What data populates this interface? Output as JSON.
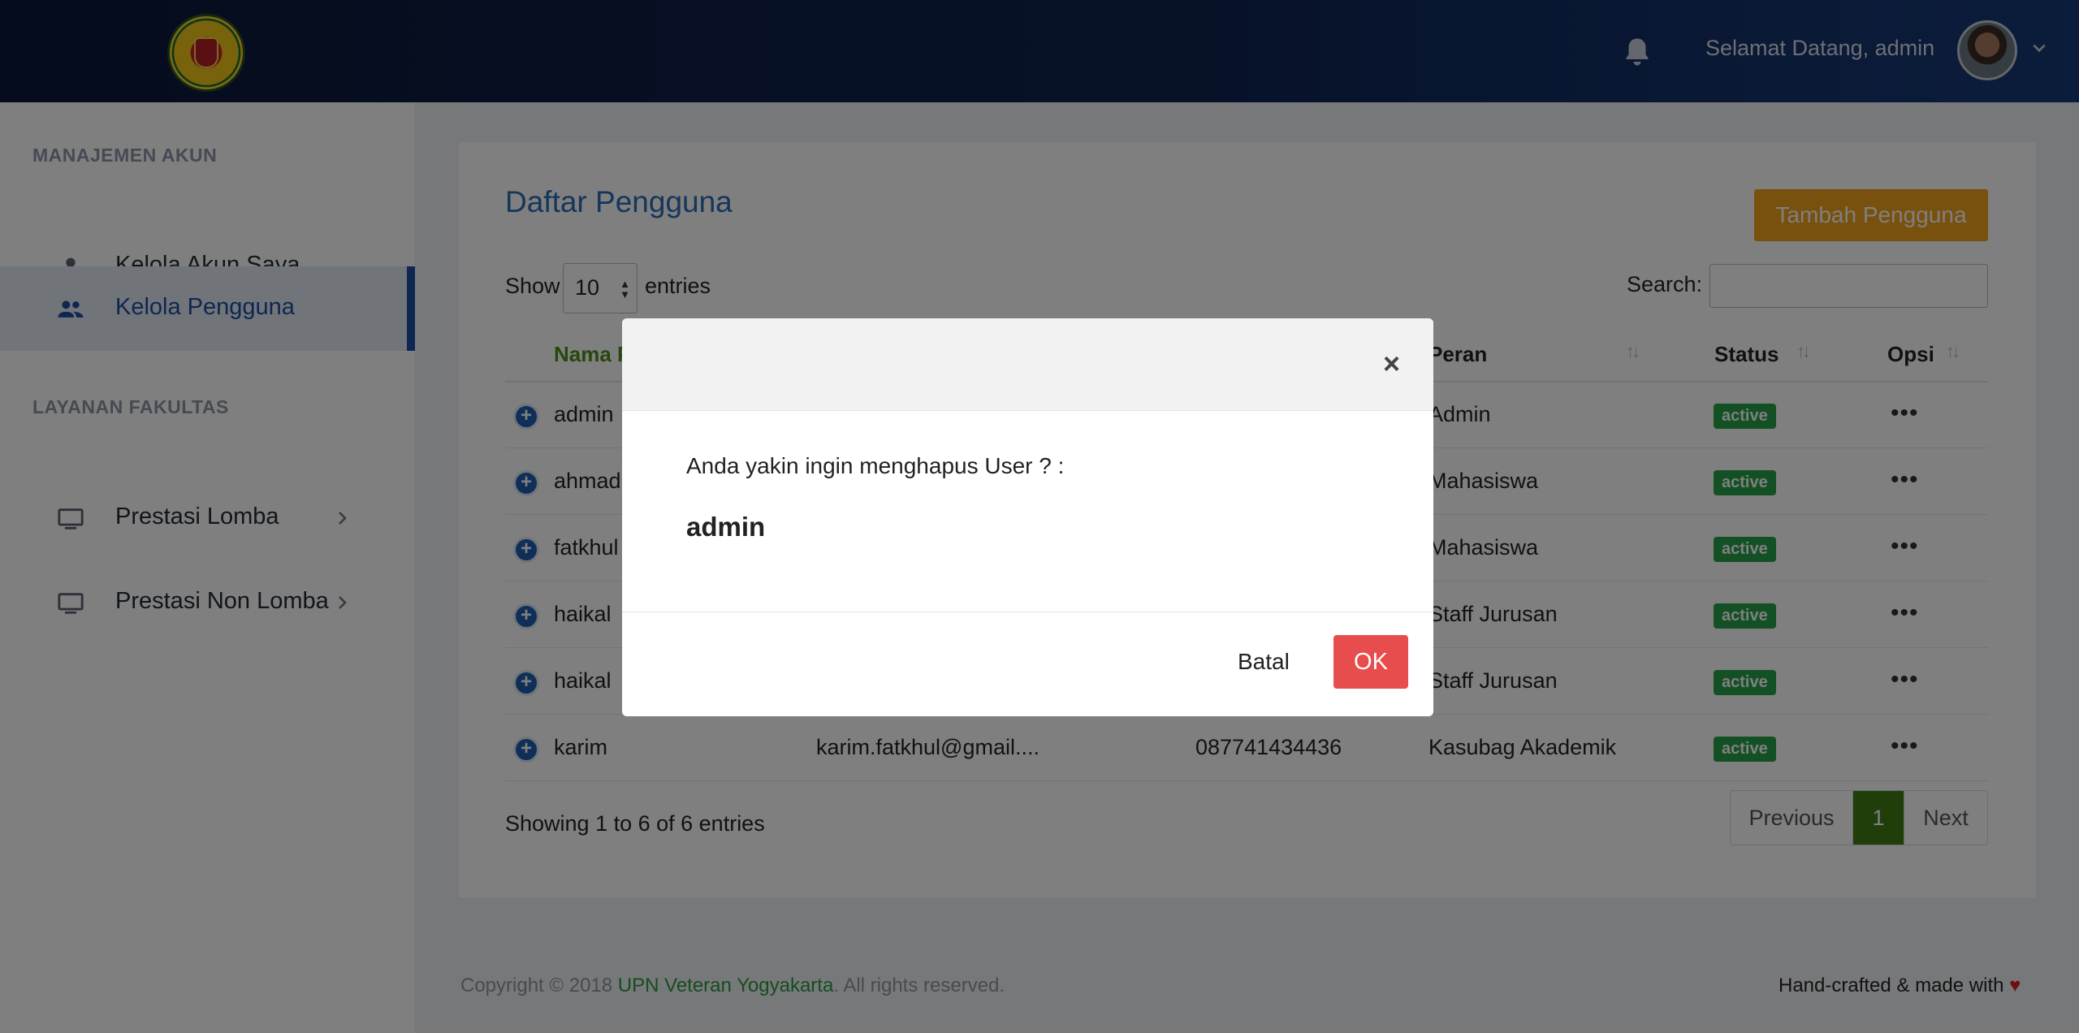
{
  "header": {
    "welcome": "Selamat Datang, admin"
  },
  "sidebar": {
    "sections": [
      {
        "heading": "MANAJEMEN AKUN"
      },
      {
        "heading": "LAYANAN FAKULTAS"
      }
    ],
    "items": [
      {
        "label": "Kelola Akun Saya",
        "icon": "person-icon"
      },
      {
        "label": "Kelola Pengguna",
        "icon": "people-icon",
        "active": true
      },
      {
        "label": "Prestasi Lomba",
        "icon": "monitor-icon"
      },
      {
        "label": "Prestasi Non Lomba",
        "icon": "monitor-icon"
      }
    ]
  },
  "main": {
    "title": "Daftar Pengguna",
    "add_button": "Tambah Pengguna",
    "show_label": "Show",
    "page_length": "10",
    "entries_label": "entries",
    "search_label": "Search:",
    "columns": [
      "Nama P",
      "Peran",
      "Status",
      "Opsi"
    ],
    "rows": [
      {
        "name": "admin",
        "email": "",
        "phone": "",
        "role": "Admin",
        "status": "active"
      },
      {
        "name": "ahmad",
        "email": "",
        "phone": "",
        "role": "Mahasiswa",
        "status": "active"
      },
      {
        "name": "fatkhul",
        "email": "",
        "phone": "",
        "role": "Mahasiswa",
        "status": "active"
      },
      {
        "name": "haikal",
        "email": "",
        "phone": "",
        "role": "Staff Jurusan",
        "status": "active"
      },
      {
        "name": "haikal",
        "email": "",
        "phone": "",
        "role": "Staff Jurusan",
        "status": "active"
      },
      {
        "name": "karim",
        "email": "karim.fatkhul@gmail....",
        "phone": "087741434436",
        "role": "Kasubag Akademik",
        "status": "active"
      }
    ],
    "info": "Showing 1 to 6 of 6 entries",
    "pagination": {
      "prev": "Previous",
      "current": "1",
      "next": "Next"
    }
  },
  "footer": {
    "copyright_prefix": "Copyright © 2018 ",
    "org": "UPN Veteran Yogyakarta",
    "copyright_suffix": ". All rights reserved.",
    "made_with": "Hand-crafted & made with",
    "heart": "♥"
  },
  "modal": {
    "close": "×",
    "question": "Anda yakin ingin menghapus User ? :",
    "target": "admin",
    "cancel": "Batal",
    "ok": "OK"
  },
  "colors": {
    "header_dark": "#0a1838",
    "accent_blue": "#1d4fa0",
    "add_button": "#f0a31c",
    "status_active": "#26a34a",
    "pagination_current": "#3f7d14",
    "ok_button": "#e84d4d"
  }
}
